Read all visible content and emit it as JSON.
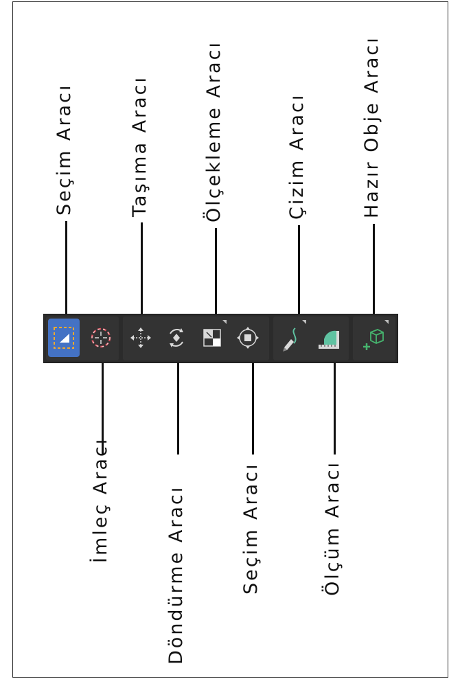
{
  "labels_top": {
    "secim": "Seçim Aracı",
    "tasima": "Taşıma Aracı",
    "olcekleme": "Ölçekleme Aracı",
    "cizim": "Çizim Aracı",
    "hazir_obje": "Hazır Obje Aracı"
  },
  "labels_bottom": {
    "imlec": "İmleç Aracı",
    "dondurme": "Döndürme Aracı",
    "secim2": "Seçim Aracı",
    "olcum": "Ölçüm Aracı"
  },
  "toolbar": {
    "tools": [
      {
        "name": "select",
        "icon": "select-box-icon",
        "active": true
      },
      {
        "name": "cursor",
        "icon": "crosshair-cursor-icon",
        "active": false
      },
      {
        "name": "move",
        "icon": "move-arrows-icon",
        "active": false
      },
      {
        "name": "rotate",
        "icon": "rotate-icon",
        "active": false
      },
      {
        "name": "scale",
        "icon": "scale-icon",
        "active": false
      },
      {
        "name": "transform",
        "icon": "transform-icon",
        "active": false
      },
      {
        "name": "annotate",
        "icon": "pencil-draw-icon",
        "active": false
      },
      {
        "name": "measure",
        "icon": "ruler-protractor-icon",
        "active": false
      },
      {
        "name": "add-object",
        "icon": "add-cube-icon",
        "active": false
      }
    ]
  },
  "colors": {
    "toolbar_bg": "#2b2b2b",
    "active_tool": "#4472c4",
    "icon": "#d9d9d9",
    "cursor_accent": "#d8505c",
    "draw_accent": "#5fc2a1",
    "cube_accent": "#46b46e"
  }
}
